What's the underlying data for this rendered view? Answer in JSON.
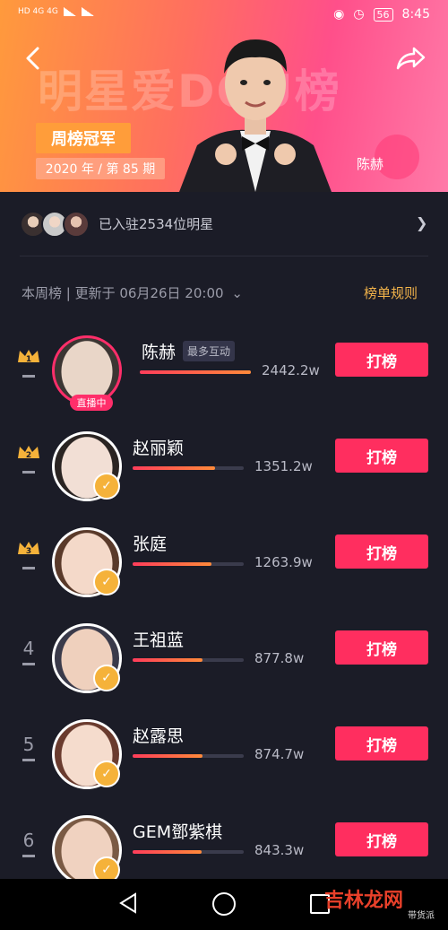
{
  "status_bar": {
    "left": "HD 4G 4G",
    "time": "8:45",
    "battery": "56"
  },
  "banner": {
    "big_title": "明星爱DOU榜",
    "champion_tag": "周榜冠军",
    "period": "2020 年 / 第 85 期",
    "hero_name": "陈赫",
    "colors": {
      "from": "#ff9a3c",
      "to": "#ff4f8a"
    }
  },
  "joined": {
    "text": "已入驻2534位明星"
  },
  "ranking_header": {
    "week_label": "本周榜 | 更新于 06月26日 20:00",
    "rules_label": "榜单规则"
  },
  "vote_label": "打榜",
  "live_label": "直播中",
  "most_interactive_label": "最多互动",
  "rows": [
    {
      "rank": "1",
      "name": "陈赫",
      "score": "2442.2w",
      "progress": 1.0
    },
    {
      "rank": "2",
      "name": "赵丽颖",
      "score": "1351.2w",
      "progress": 0.74
    },
    {
      "rank": "3",
      "name": "张庭",
      "score": "1263.9w",
      "progress": 0.71
    },
    {
      "rank": "4",
      "name": "王祖蓝",
      "score": "877.8w",
      "progress": 0.63
    },
    {
      "rank": "5",
      "name": "赵露思",
      "score": "874.7w",
      "progress": 0.63
    },
    {
      "rank": "6",
      "name": "GEM鄧紫棋",
      "score": "843.3w",
      "progress": 0.62
    }
  ],
  "watermark": {
    "main": "吉林龙网",
    "sub": "带货派"
  },
  "icons": [
    "back-icon",
    "share-icon",
    "chevron-right-icon",
    "chevron-down-icon",
    "crown-icon",
    "verified-icon",
    "nav-back-icon",
    "nav-home-icon",
    "nav-recents-icon"
  ]
}
